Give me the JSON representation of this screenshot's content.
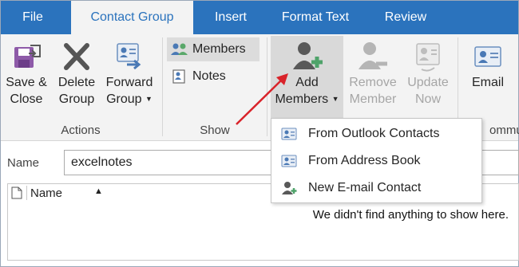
{
  "tabs": [
    "File",
    "Contact Group",
    "Insert",
    "Format Text",
    "Review"
  ],
  "ribbon": {
    "actions": {
      "group_label": "Actions",
      "save_close": [
        "Save &",
        "Close"
      ],
      "delete_group": [
        "Delete",
        "Group"
      ],
      "forward_group": [
        "Forward",
        "Group"
      ]
    },
    "show": {
      "group_label": "Show",
      "members": "Members",
      "notes": "Notes"
    },
    "members": {
      "add_members": [
        "Add",
        "Members"
      ],
      "remove_member": [
        "Remove",
        "Member"
      ],
      "update_now": [
        "Update",
        "Now"
      ]
    },
    "communicate": {
      "email": "Email",
      "group_label_partial": "ommu"
    }
  },
  "name_field": {
    "label": "Name",
    "value": "excelnotes"
  },
  "list": {
    "column_name": "Name",
    "empty_message": "We didn't find anything to show here."
  },
  "add_members_menu": [
    {
      "label": "From Outlook Contacts",
      "icon": "address-card-icon"
    },
    {
      "label": "From Address Book",
      "icon": "address-book-icon"
    },
    {
      "label": "New E-mail Contact",
      "icon": "new-contact-icon"
    }
  ],
  "colors": {
    "tab_bar": "#2b73bd",
    "ribbon_bg": "#f3f3f3",
    "annotation_arrow": "#d9232a"
  }
}
